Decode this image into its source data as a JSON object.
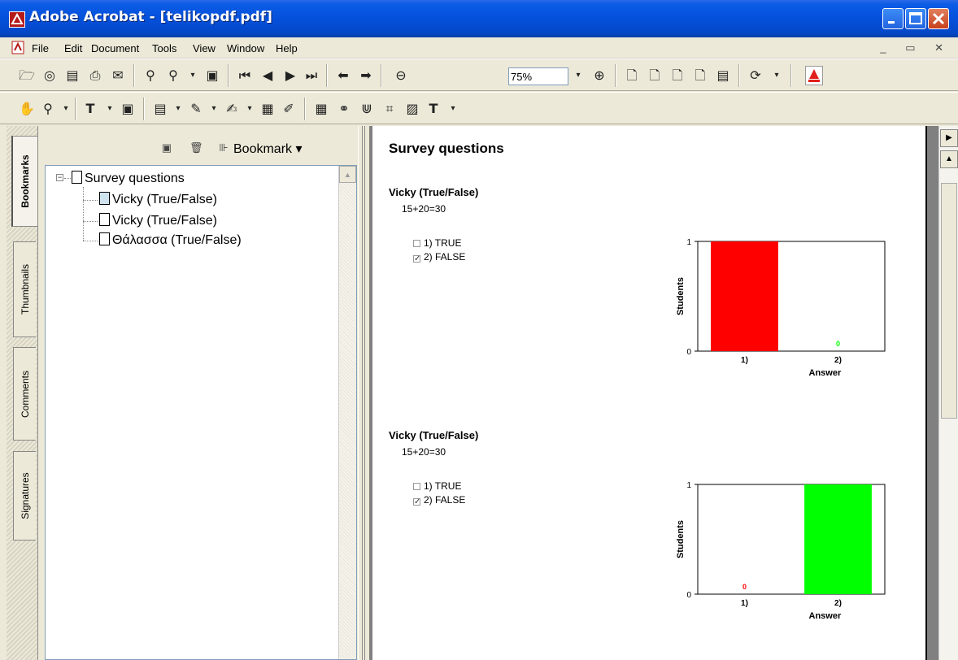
{
  "window": {
    "title": "Adobe Acrobat - [telikopdf.pdf]"
  },
  "menu": {
    "items": [
      "File",
      "Edit",
      "Document",
      "Tools",
      "View",
      "Window",
      "Help"
    ]
  },
  "toolbar": {
    "zoom_value": "75%"
  },
  "nav": {
    "tabs": [
      "Bookmarks",
      "Thumbnails",
      "Comments",
      "Signatures"
    ],
    "bookmark_menu": "Bookmark ▾",
    "tree": {
      "root": "Survey questions",
      "children": [
        "Vicky (True/False)",
        "Vicky (True/False)",
        "Θάλασσα (True/False)"
      ]
    }
  },
  "document": {
    "heading": "Survey questions",
    "questions": [
      {
        "title": "Vicky (True/False)",
        "text": "15+20=30",
        "options": [
          {
            "label": "1) TRUE",
            "checked": false
          },
          {
            "label": "2) FALSE",
            "checked": true
          }
        ]
      },
      {
        "title": "Vicky (True/False)",
        "text": "15+20=30",
        "options": [
          {
            "label": "1) TRUE",
            "checked": false
          },
          {
            "label": "2) FALSE",
            "checked": true
          }
        ]
      }
    ]
  },
  "chart_data": [
    {
      "type": "bar",
      "categories": [
        "1)",
        "2)"
      ],
      "values": [
        1,
        0
      ],
      "colors": [
        "#ff0000",
        "#00ff00"
      ],
      "xlabel": "Answer",
      "ylabel": "Students",
      "ylim": [
        0,
        1
      ],
      "yticks": [
        "0",
        "1"
      ],
      "data_labels": [
        "",
        "0"
      ]
    },
    {
      "type": "bar",
      "categories": [
        "1)",
        "2)"
      ],
      "values": [
        0,
        1
      ],
      "colors": [
        "#ff0000",
        "#00ff00"
      ],
      "xlabel": "Answer",
      "ylabel": "Students",
      "ylim": [
        0,
        1
      ],
      "yticks": [
        "0",
        "1"
      ],
      "data_labels": [
        "0",
        ""
      ]
    }
  ]
}
